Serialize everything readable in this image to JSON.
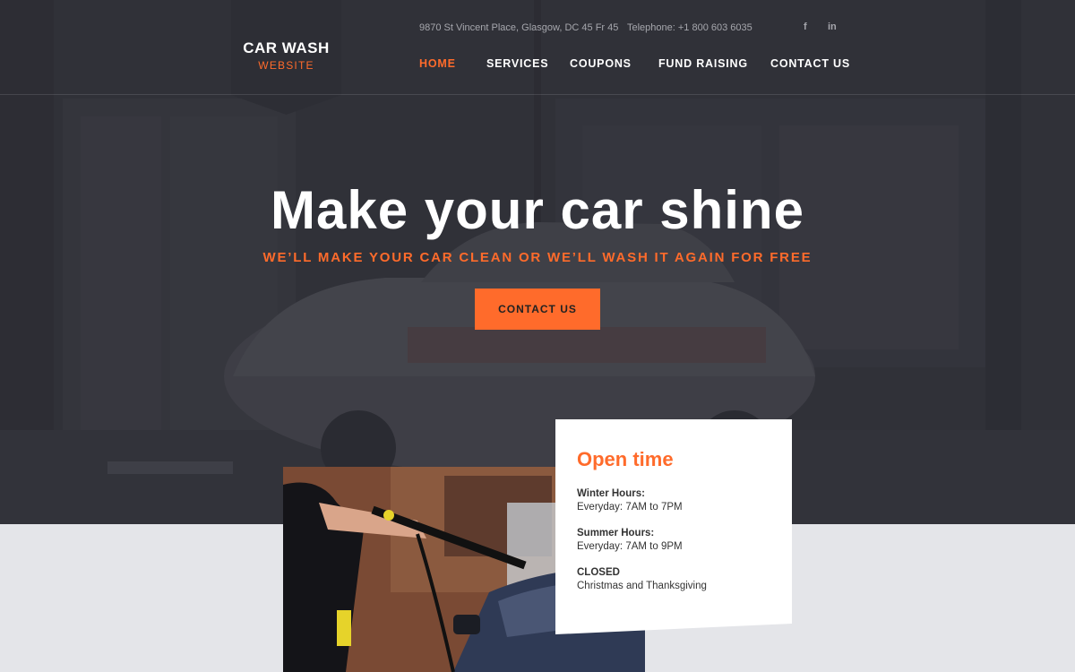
{
  "brand": {
    "title": "CAR WASH",
    "subtitle": "WEBSITE"
  },
  "topbar": {
    "address": "9870 St Vincent Place, Glasgow, DC 45 Fr 45",
    "phone": "Telephone: +1 800 603 6035",
    "social": {
      "facebook": "f",
      "linkedin": "in"
    }
  },
  "nav": {
    "home": "HOME",
    "services": "SERVICES",
    "coupons": "COUPONS",
    "fund_raising": "FUND RAISING",
    "contact": "CONTACT US"
  },
  "hero": {
    "title": "Make your car shine",
    "subtitle": "WE’LL MAKE YOUR CAR CLEAN OR WE’LL WASH IT AGAIN FOR FREE",
    "button": "CONTACT US"
  },
  "open_time": {
    "title": "Open time",
    "winter_label": "Winter Hours:",
    "winter_value": "Everyday: 7AM to 7PM",
    "summer_label": "Summer Hours:",
    "summer_value": "Everyday: 7AM to 9PM",
    "closed_label": "CLOSED",
    "closed_value": "Christmas and Thanksgiving"
  },
  "colors": {
    "accent": "#ff6b2b",
    "dark": "#2d2e35",
    "light_bg": "#e4e5e9"
  }
}
